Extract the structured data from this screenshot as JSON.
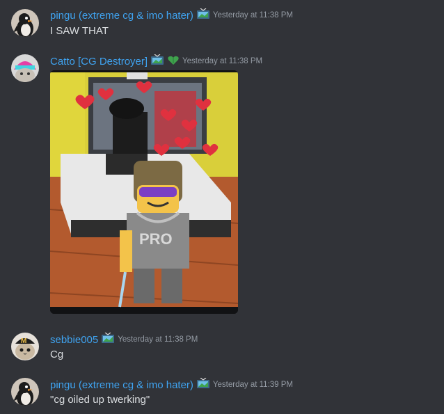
{
  "messages": [
    {
      "username": "pingu (extreme cg & imo hater)",
      "timestamp": "Yesterday at 11:38 PM",
      "text": "I SAW THAT",
      "avatar": "penguin-avatar",
      "badges": [
        "tv-icon"
      ]
    },
    {
      "username": "Catto [CG Destroyer]",
      "timestamp": "Yesterday at 11:38 PM",
      "text": "",
      "avatar": "cat-avatar",
      "badges": [
        "tv-icon",
        "leaf-heart-icon"
      ],
      "attachment": {
        "type": "image",
        "description_icon": "game-screenshot-image"
      }
    },
    {
      "username": "sebbie005",
      "timestamp": "Yesterday at 11:38 PM",
      "text": "Cg",
      "avatar": "cat-cap-avatar",
      "badges": [
        "tv-icon"
      ]
    },
    {
      "username": "pingu (extreme cg & imo hater)",
      "timestamp": "Yesterday at 11:39 PM",
      "text": "\"cg oiled up twerking\"",
      "avatar": "penguin-avatar",
      "badges": [
        "tv-icon"
      ]
    }
  ],
  "colors": {
    "background": "#313338",
    "username": "#3fa3f0",
    "timestamp": "#949ba4",
    "text": "#dbdee1"
  }
}
